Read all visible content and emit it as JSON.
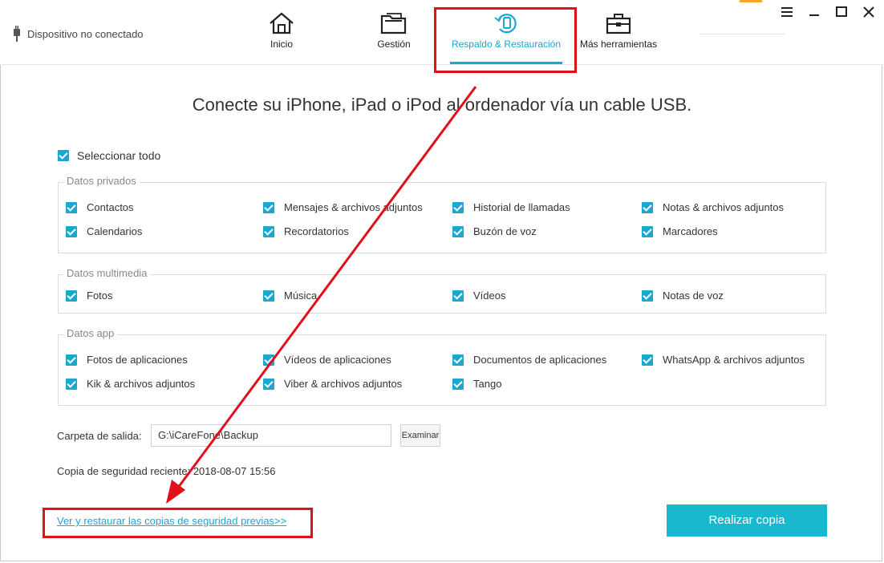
{
  "topbar": {
    "device_status": "Dispositivo no conectado",
    "tabs": [
      {
        "label": "Inicio",
        "icon": "home-icon"
      },
      {
        "label": "Gestión",
        "icon": "folder-icon"
      },
      {
        "label": "Respaldo & Restauración",
        "icon": "backup-restore-icon"
      },
      {
        "label": "Más herramientas",
        "icon": "toolbox-icon"
      }
    ]
  },
  "headline": "Conecte su iPhone, iPad o iPod al ordenador vía un cable USB.",
  "select_all": "Seleccionar todo",
  "groups": [
    {
      "title": "Datos privados",
      "items": [
        "Contactos",
        "Mensajes & archivos adjuntos",
        "Historial de llamadas",
        "Notas & archivos adjuntos",
        "Calendarios",
        "Recordatorios",
        "Buzón de voz",
        "Marcadores"
      ]
    },
    {
      "title": "Datos multimedia",
      "items": [
        "Fotos",
        "Música",
        "Vídeos",
        "Notas de voz"
      ]
    },
    {
      "title": "Datos app",
      "items": [
        "Fotos de aplicaciones",
        "Vídeos de aplicaciones",
        "Documentos de aplicaciones",
        "WhatsApp & archivos adjuntos",
        "Kik & archivos adjuntos",
        "Viber & archivos adjuntos",
        "Tango"
      ]
    }
  ],
  "output": {
    "label": "Carpeta de salida:",
    "value": "G:\\iCareFone\\Backup",
    "browse_label": "Examinar"
  },
  "recent_backup": "Copia de seguridad reciente: 2018-08-07 15:56",
  "restore_link": "Ver y restaurar las copias de seguridad previas>>",
  "backup_button": "Realizar copia",
  "colors": {
    "accent": "#1aa7d0",
    "button": "#19b8cf",
    "annotation": "#e0101b"
  }
}
